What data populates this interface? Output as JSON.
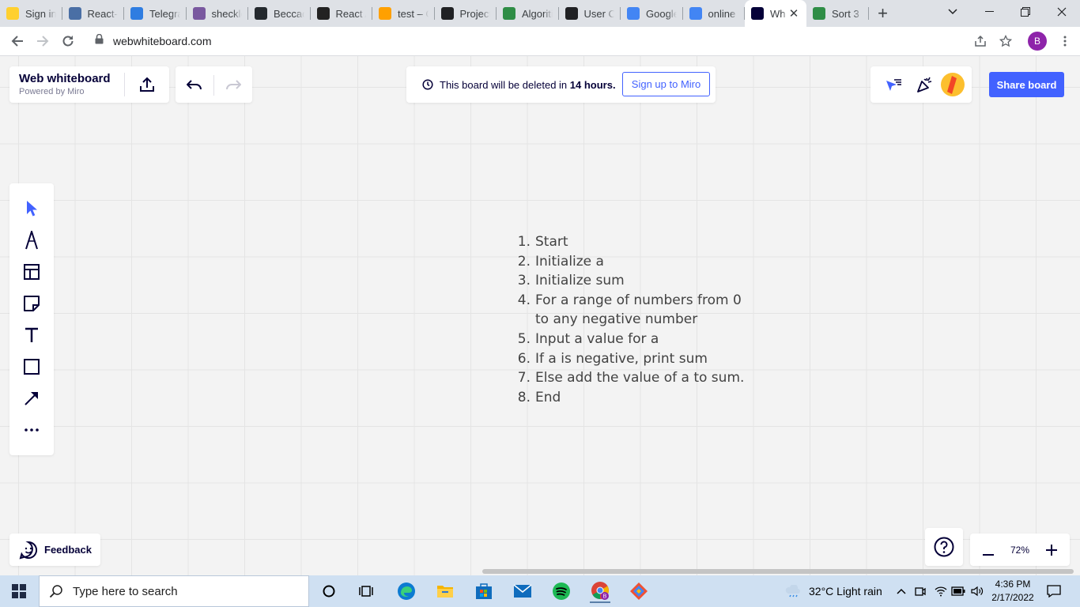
{
  "browser": {
    "tabs": [
      {
        "title": "Sign in",
        "icon": "miro-icon",
        "color": "#ffd02f",
        "active": false
      },
      {
        "title": "React-S",
        "icon": "doc-icon",
        "color": "#4a6fa5",
        "active": false
      },
      {
        "title": "Telegra",
        "icon": "telegram-icon",
        "color": "#2f7de1",
        "active": false
      },
      {
        "title": "sheckle",
        "icon": "heroku-icon",
        "color": "#79589f",
        "active": false
      },
      {
        "title": "Beccad",
        "icon": "github-icon",
        "color": "#24292e",
        "active": false
      },
      {
        "title": "React A",
        "icon": "react-icon",
        "color": "#222222",
        "active": false
      },
      {
        "title": "test – C",
        "icon": "firebase-icon",
        "color": "#ffa000",
        "active": false
      },
      {
        "title": "Project",
        "icon": "alx-icon",
        "color": "#202124",
        "active": false
      },
      {
        "title": "Algoriti",
        "icon": "gfg-icon",
        "color": "#2f8d46",
        "active": false
      },
      {
        "title": "User Co",
        "icon": "alx-icon",
        "color": "#202124",
        "active": false
      },
      {
        "title": "Google",
        "icon": "gdocs-icon",
        "color": "#4285f4",
        "active": false
      },
      {
        "title": "online",
        "icon": "google-icon",
        "color": "#4285f4",
        "active": false
      },
      {
        "title": "Wh",
        "icon": "webwhiteboard-icon",
        "color": "#050038",
        "active": true
      },
      {
        "title": "Sort 3",
        "icon": "gfg-icon",
        "color": "#2f8d46",
        "active": false
      }
    ],
    "url": "webwhiteboard.com",
    "profile_initial": "B"
  },
  "board": {
    "title": "Web whiteboard",
    "subtitle": "Powered by Miro",
    "notice_prefix": "This board will be deleted in",
    "notice_bold": "14 hours.",
    "signup_label": "Sign up to Miro",
    "share_label": "Share board",
    "feedback_label": "Feedback",
    "zoom": "72%",
    "accent": "#4262ff"
  },
  "note": {
    "items": [
      {
        "num": "1.",
        "text": "Start"
      },
      {
        "num": "2.",
        "text": "Initialize a"
      },
      {
        "num": "3.",
        "text": "Initialize sum"
      },
      {
        "num": "4.",
        "text": "For a range of numbers from 0 to any negative number"
      },
      {
        "num": "5.",
        "text": "Input a value for a"
      },
      {
        "num": "6.",
        "text": "If a is negative, print sum"
      },
      {
        "num": "7.",
        "text": "Else add the value of a to sum."
      },
      {
        "num": "8.",
        "text": "End"
      }
    ]
  },
  "taskbar": {
    "search_placeholder": "Type here to search",
    "weather": "32°C  Light rain",
    "time": "4:36 PM",
    "date": "2/17/2022"
  }
}
